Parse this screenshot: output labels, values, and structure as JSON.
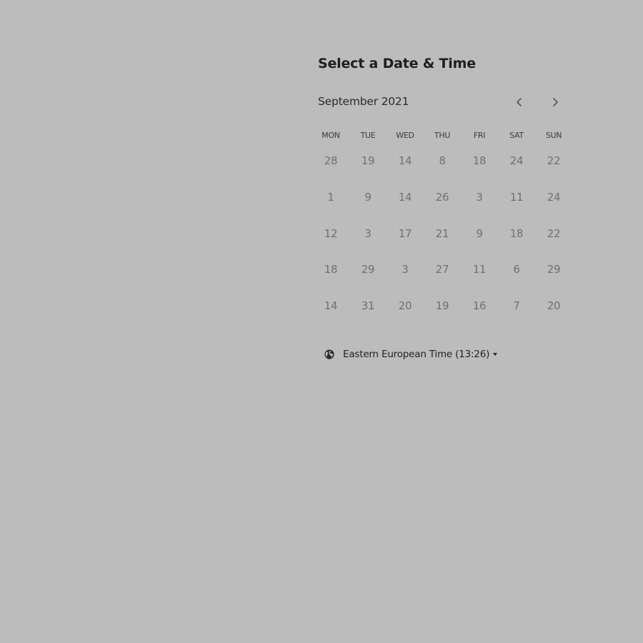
{
  "scheduler": {
    "title": "Select a Date & Time",
    "month_label": "September 2021",
    "prev_icon": "chevron-left-icon",
    "next_icon": "chevron-right-icon",
    "weekdays": [
      "MON",
      "TUE",
      "WED",
      "THU",
      "FRI",
      "SAT",
      "SUN"
    ],
    "weeks": [
      [
        "28",
        "19",
        "14",
        "8",
        "18",
        "24",
        "22"
      ],
      [
        "1",
        "9",
        "14",
        "26",
        "3",
        "11",
        "24"
      ],
      [
        "12",
        "3",
        "17",
        "21",
        "9",
        "18",
        "22"
      ],
      [
        "18",
        "29",
        "3",
        "27",
        "11",
        "6",
        "29"
      ],
      [
        "14",
        "31",
        "20",
        "19",
        "16",
        "7",
        "20"
      ]
    ],
    "timezone": {
      "icon": "globe-icon",
      "label": "Eastern European Time (13:26)",
      "caret_icon": "caret-down-icon"
    }
  },
  "colors": {
    "background": "#bcbcbc",
    "text_dark": "#1e1e1e",
    "day_text": "#707070"
  }
}
